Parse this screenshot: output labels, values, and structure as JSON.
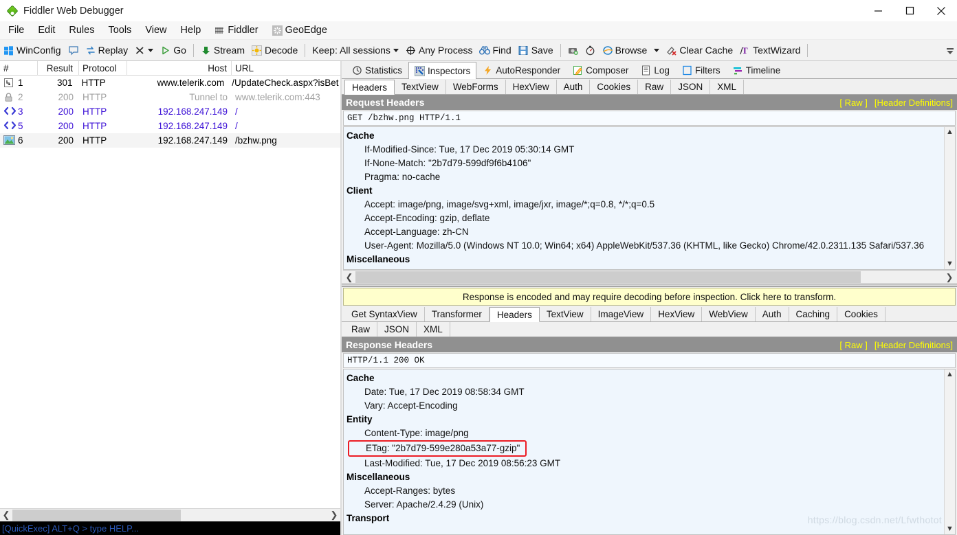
{
  "window": {
    "title": "Fiddler Web Debugger",
    "app_icon": "fiddler-diamond-icon",
    "minimize": "minimize-icon",
    "maximize": "maximize-icon",
    "close": "close-icon"
  },
  "menubar": {
    "items": [
      {
        "label": "File",
        "icon": null
      },
      {
        "label": "Edit",
        "icon": null
      },
      {
        "label": "Rules",
        "icon": null
      },
      {
        "label": "Tools",
        "icon": null
      },
      {
        "label": "View",
        "icon": null
      },
      {
        "label": "Help",
        "icon": null
      },
      {
        "label": "Fiddler",
        "icon": "fiddler-grid-icon"
      },
      {
        "label": "GeoEdge",
        "icon": "geoedge-icon"
      }
    ]
  },
  "toolbar": {
    "items": [
      {
        "label": "WinConfig",
        "icon": "windows-icon"
      },
      {
        "label": "",
        "icon": "comment-icon"
      },
      {
        "label": "Replay",
        "icon": "replay-icon"
      },
      {
        "label": "",
        "icon": "remove-x-icon",
        "caret": true
      },
      {
        "label": "Go",
        "icon": "play-icon"
      },
      {
        "sep": true
      },
      {
        "label": "Stream",
        "icon": "stream-arrow-icon"
      },
      {
        "label": "Decode",
        "icon": "decode-icon"
      },
      {
        "sep": true
      },
      {
        "label": "Keep: All sessions",
        "icon": null,
        "caret": true
      },
      {
        "label": "Any Process",
        "icon": "target-icon"
      },
      {
        "label": "Find",
        "icon": "binoculars-icon"
      },
      {
        "label": "Save",
        "icon": "save-icon"
      },
      {
        "sep": true
      },
      {
        "label": "",
        "icon": "camera-icon"
      },
      {
        "label": "",
        "icon": "timer-icon"
      },
      {
        "label": "Browse",
        "icon": "ie-browser-icon",
        "caret": true
      },
      {
        "label": "Clear Cache",
        "icon": "clear-cache-icon"
      },
      {
        "label": "TextWizard",
        "icon": "textwizard-icon"
      },
      {
        "sep": true
      }
    ],
    "overflow_icon": "toolbar-overflow-icon"
  },
  "sessions": {
    "columns": [
      "#",
      "Result",
      "Protocol",
      "Host",
      "URL"
    ],
    "rows": [
      {
        "icon": "arrow-redirect-icon",
        "num": "1",
        "result": "301",
        "protocol": "HTTP",
        "host": "www.telerik.com",
        "url": "/UpdateCheck.aspx?isBet",
        "style": "black",
        "selected": false
      },
      {
        "icon": "lock-icon",
        "num": "2",
        "result": "200",
        "protocol": "HTTP",
        "host": "Tunnel to",
        "url": "www.telerik.com:443",
        "style": "gray",
        "selected": false
      },
      {
        "icon": "html-icon",
        "num": "3",
        "result": "200",
        "protocol": "HTTP",
        "host": "192.168.247.149",
        "url": "/",
        "style": "blue",
        "selected": false
      },
      {
        "icon": "html-icon",
        "num": "5",
        "result": "200",
        "protocol": "HTTP",
        "host": "192.168.247.149",
        "url": "/",
        "style": "blue",
        "selected": false
      },
      {
        "icon": "image-icon",
        "num": "6",
        "result": "200",
        "protocol": "HTTP",
        "host": "192.168.247.149",
        "url": "/bzhw.png",
        "style": "black",
        "selected": true
      }
    ]
  },
  "quickexec": {
    "text": "[QuickExec] ALT+Q > type HELP..."
  },
  "inspector": {
    "main_tabs": [
      {
        "label": "Statistics",
        "icon": "statistics-clock-icon",
        "active": false
      },
      {
        "label": "Inspectors",
        "icon": "inspectors-icon",
        "active": true
      },
      {
        "label": "AutoResponder",
        "icon": "lightning-icon",
        "active": false
      },
      {
        "label": "Composer",
        "icon": "composer-pencil-icon",
        "active": false
      },
      {
        "label": "Log",
        "icon": "log-icon",
        "active": false
      },
      {
        "label": "Filters",
        "icon": "filters-icon",
        "active": false
      },
      {
        "label": "Timeline",
        "icon": "timeline-icon",
        "active": false
      }
    ],
    "request_tabs": [
      {
        "label": "Headers",
        "active": true
      },
      {
        "label": "TextView",
        "active": false
      },
      {
        "label": "WebForms",
        "active": false
      },
      {
        "label": "HexView",
        "active": false
      },
      {
        "label": "Auth",
        "active": false
      },
      {
        "label": "Cookies",
        "active": false
      },
      {
        "label": "Raw",
        "active": false
      },
      {
        "label": "JSON",
        "active": false
      },
      {
        "label": "XML",
        "active": false
      }
    ],
    "request": {
      "panel_title": "Request Headers",
      "raw_link": "[ Raw ]",
      "defs_link": "[Header Definitions]",
      "request_line": "GET /bzhw.png HTTP/1.1",
      "groups": [
        {
          "name": "Cache",
          "items": [
            "If-Modified-Since: Tue, 17 Dec 2019 05:30:14 GMT",
            "If-None-Match: \"2b7d79-599df9f6b4106\"",
            "Pragma: no-cache"
          ]
        },
        {
          "name": "Client",
          "items": [
            "Accept: image/png, image/svg+xml, image/jxr, image/*;q=0.8, */*;q=0.5",
            "Accept-Encoding: gzip, deflate",
            "Accept-Language: zh-CN",
            "User-Agent: Mozilla/5.0 (Windows NT 10.0; Win64; x64) AppleWebKit/537.36 (KHTML, like Gecko) Chrome/42.0.2311.135 Safari/537.36"
          ]
        },
        {
          "name": "Miscellaneous",
          "items": []
        }
      ]
    },
    "notice": "Response is encoded and may require decoding before inspection. Click here to transform.",
    "response_tabs_row1": [
      {
        "label": "Get SyntaxView",
        "active": false
      },
      {
        "label": "Transformer",
        "active": false
      },
      {
        "label": "Headers",
        "active": true
      },
      {
        "label": "TextView",
        "active": false
      },
      {
        "label": "ImageView",
        "active": false
      },
      {
        "label": "HexView",
        "active": false
      },
      {
        "label": "WebView",
        "active": false
      },
      {
        "label": "Auth",
        "active": false
      },
      {
        "label": "Caching",
        "active": false
      },
      {
        "label": "Cookies",
        "active": false
      }
    ],
    "response_tabs_row2": [
      {
        "label": "Raw",
        "active": false
      },
      {
        "label": "JSON",
        "active": false
      },
      {
        "label": "XML",
        "active": false
      }
    ],
    "response": {
      "panel_title": "Response Headers",
      "raw_link": "[ Raw ]",
      "defs_link": "[Header Definitions]",
      "status_line": "HTTP/1.1 200 OK",
      "groups": [
        {
          "name": "Cache",
          "items": [
            {
              "text": "Date: Tue, 17 Dec 2019 08:58:34 GMT",
              "highlighted": false
            },
            {
              "text": "Vary: Accept-Encoding",
              "highlighted": false
            }
          ]
        },
        {
          "name": "Entity",
          "items": [
            {
              "text": "Content-Type: image/png",
              "highlighted": false
            },
            {
              "text": "ETag: \"2b7d79-599e280a53a77-gzip\"",
              "highlighted": true
            },
            {
              "text": "Last-Modified: Tue, 17 Dec 2019 08:56:23 GMT",
              "highlighted": false
            }
          ]
        },
        {
          "name": "Miscellaneous",
          "items": [
            {
              "text": "Accept-Ranges: bytes",
              "highlighted": false
            },
            {
              "text": "Server: Apache/2.4.29 (Unix)",
              "highlighted": false
            }
          ]
        },
        {
          "name": "Transport",
          "items": []
        }
      ]
    }
  },
  "watermark": "https://blog.csdn.net/Lfwthotot",
  "colors": {
    "highlight_box": "#ec1c24",
    "panel_header_bg": "#909090",
    "panel_header_link": "#ffff00",
    "notice_bg": "#ffffcc",
    "blue_row": "#3b0fd6",
    "gray_row": "#a0a0a0",
    "body_bg": "#eff6fd"
  }
}
